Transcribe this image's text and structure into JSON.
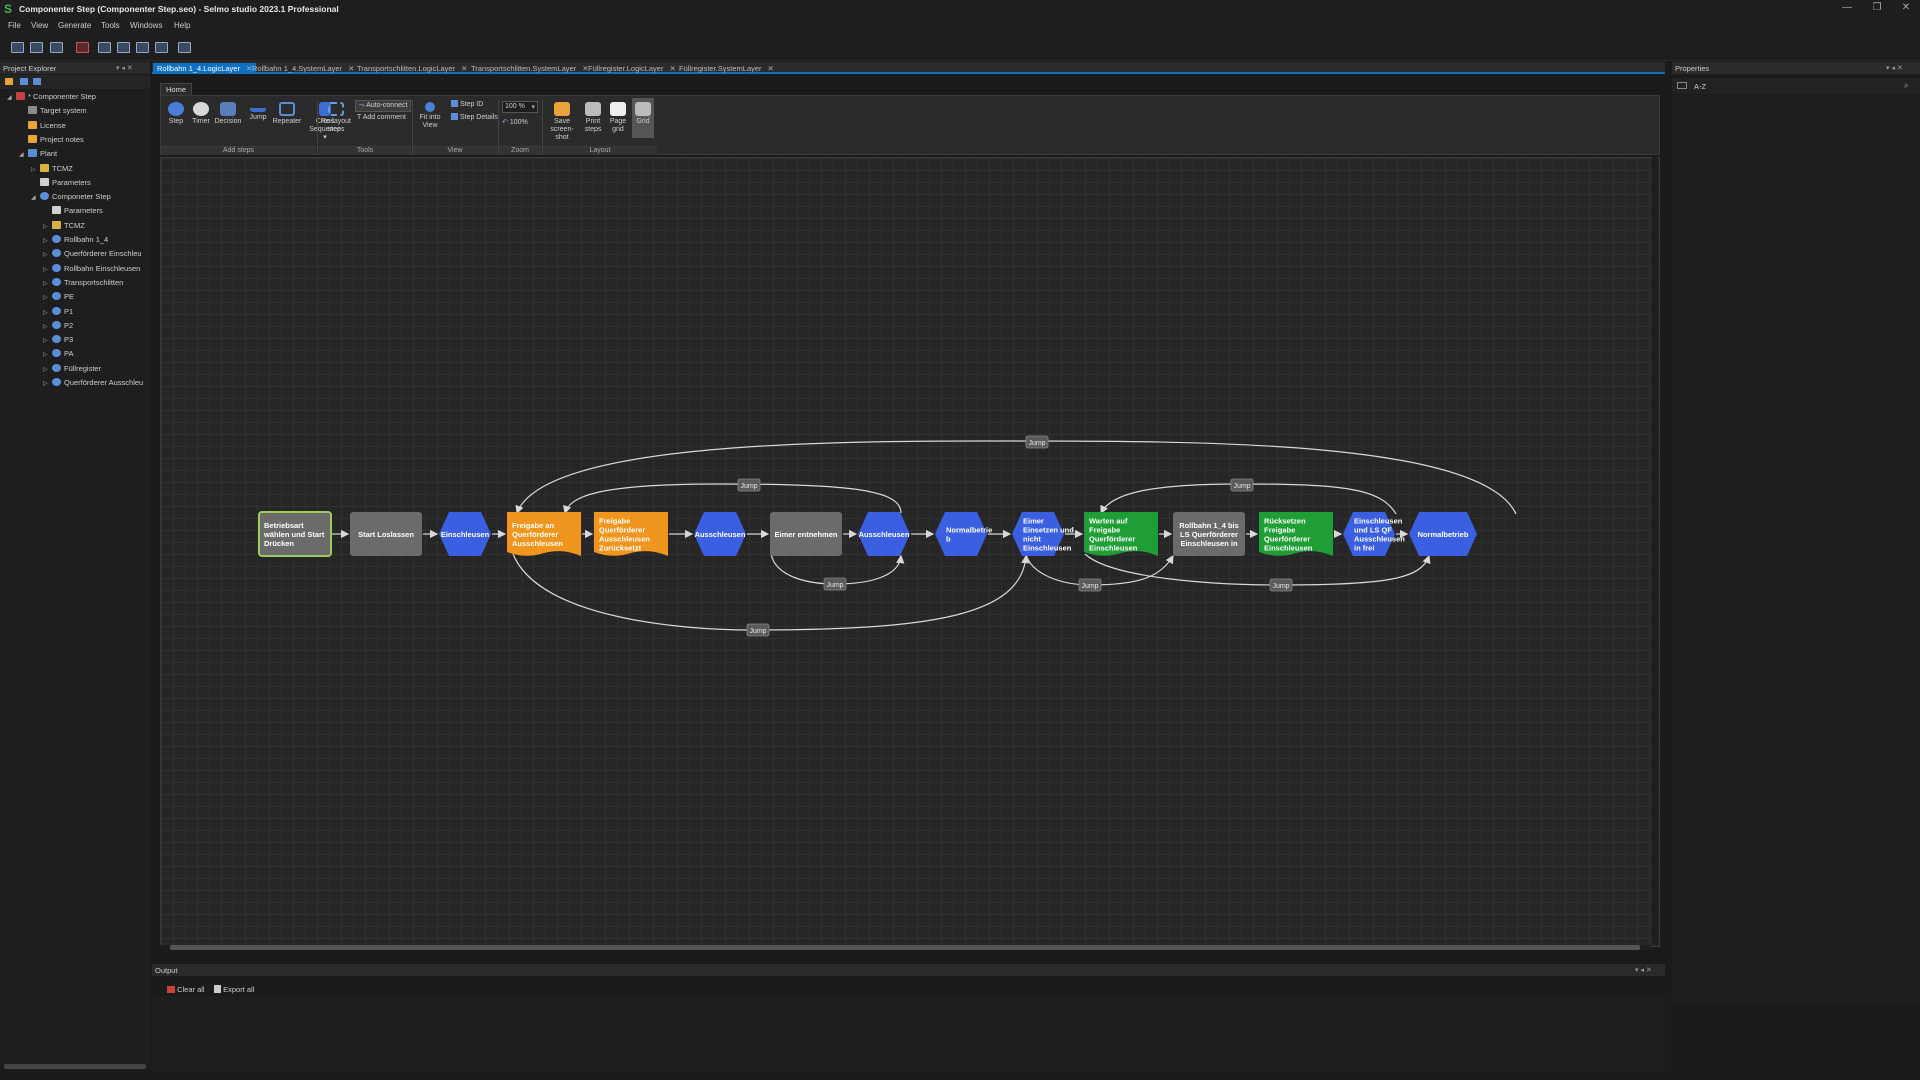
{
  "app": {
    "title": "Componenter Step (Componenter Step.seo) - Selmo studio 2023.1 Professional",
    "logo_glyph": "S",
    "window_buttons": [
      "—",
      "❐",
      "✕"
    ]
  },
  "menu": [
    "File",
    "View",
    "Generate",
    "Tools",
    "Windows",
    "Help"
  ],
  "project_explorer": {
    "title": "Project Explorer",
    "tree": [
      {
        "label": "* Componenter Step",
        "depth": 0,
        "arrow": "◢",
        "icon": "project-icon"
      },
      {
        "label": "Target system",
        "depth": 1,
        "arrow": "",
        "icon": "target-icon"
      },
      {
        "label": "License",
        "depth": 1,
        "arrow": "",
        "icon": "license-icon"
      },
      {
        "label": "Project notes",
        "depth": 1,
        "arrow": "",
        "icon": "notes-icon"
      },
      {
        "label": "Plant",
        "depth": 1,
        "arrow": "◢",
        "icon": "plant-icon"
      },
      {
        "label": "TCMZ",
        "depth": 2,
        "arrow": "▷",
        "icon": "folder-icon"
      },
      {
        "label": "Parameters",
        "depth": 2,
        "arrow": "",
        "icon": "parameters-icon"
      },
      {
        "label": "Componeter Step",
        "depth": 2,
        "arrow": "◢",
        "icon": "component-icon"
      },
      {
        "label": "Parameters",
        "depth": 3,
        "arrow": "",
        "icon": "parameters-icon"
      },
      {
        "label": "TCMZ",
        "depth": 3,
        "arrow": "▷",
        "icon": "folder-icon"
      },
      {
        "label": "Rollbahn 1_4",
        "depth": 3,
        "arrow": "▷",
        "icon": "component-icon"
      },
      {
        "label": "Querförderer Einschleu",
        "depth": 3,
        "arrow": "▷",
        "icon": "component-icon"
      },
      {
        "label": "Rollbahn Einschleusen",
        "depth": 3,
        "arrow": "▷",
        "icon": "component-icon"
      },
      {
        "label": "Transportschlitten",
        "depth": 3,
        "arrow": "▷",
        "icon": "component-icon"
      },
      {
        "label": "PE",
        "depth": 3,
        "arrow": "▷",
        "icon": "component-icon"
      },
      {
        "label": "P1",
        "depth": 3,
        "arrow": "▷",
        "icon": "component-icon"
      },
      {
        "label": "P2",
        "depth": 3,
        "arrow": "▷",
        "icon": "component-icon"
      },
      {
        "label": "P3",
        "depth": 3,
        "arrow": "▷",
        "icon": "component-icon"
      },
      {
        "label": "PA",
        "depth": 3,
        "arrow": "▷",
        "icon": "component-icon"
      },
      {
        "label": "Füllregister",
        "depth": 3,
        "arrow": "▷",
        "icon": "component-icon"
      },
      {
        "label": "Querförderer Ausschleu",
        "depth": 3,
        "arrow": "▷",
        "icon": "component-icon"
      }
    ]
  },
  "tabs": [
    {
      "label": "Rollbahn 1_4.LogicLayer",
      "active": true
    },
    {
      "label": "Rollbahn 1_4.SystemLayer",
      "active": false
    },
    {
      "label": "Transportschlitten.LogicLayer",
      "active": false
    },
    {
      "label": "Transportschlitten.SystemLayer",
      "active": false
    },
    {
      "label": "Füllregister.LogicLayer",
      "active": false
    },
    {
      "label": "Füllregister.SystemLayer",
      "active": false
    }
  ],
  "tab_close_glyph": "✕",
  "ribbon": {
    "tab": "Home",
    "buttons": {
      "step": "Step",
      "timer": "Timer",
      "decision": "Decision",
      "jump": "Jump",
      "repeater": "Repeater",
      "cross_sequence": "Cross Sequence ▾",
      "relayout": "Re-layout steps",
      "auto_connect": "Auto-connect",
      "add_comment": "Add comment",
      "fit_into_view": "Fit into View",
      "step_id": "Step ID",
      "step_details": "Step Details",
      "zoom_value": "100 %",
      "zoom_reset": "100%",
      "save_screenshot": "Save screen-shot",
      "print_steps": "Print steps",
      "page_grid": "Page grid",
      "grid": "Grid"
    },
    "groups": {
      "add_steps": "Add steps",
      "tools": "Tools",
      "view": "View",
      "zoom": "Zoom",
      "layout": "Layout"
    },
    "colors": {
      "step": "#4a7fd4",
      "timer": "#d8d8d8",
      "decision": "#5a7fb8",
      "jump": "#3c6fd0",
      "repeater": "#5a8fd8",
      "save": "#e8a43a"
    }
  },
  "diagram": {
    "colors": {
      "blue": "#3a5fe0",
      "orange": "#f0961e",
      "gray": "#6b6b6b",
      "green": "#1f9e35",
      "init_border": "#9ccc5a",
      "line": "#d8d8d8",
      "jump_label_bg": "#5a5a5a"
    },
    "steps": [
      {
        "id": "s1",
        "text": [
          "Betriebsart",
          "wählen und Start",
          "Drücken"
        ],
        "kind": "init"
      },
      {
        "id": "s2",
        "text": [
          "Start Loslassen"
        ],
        "kind": "gray"
      },
      {
        "id": "s3",
        "text": [
          "Einschleusen"
        ],
        "kind": "blue-hex"
      },
      {
        "id": "s4",
        "text": [
          "Freigabe an",
          "Querförderer",
          "Ausschleusen"
        ],
        "kind": "orange"
      },
      {
        "id": "s5",
        "text": [
          "Freigabe",
          "Querförderer",
          "Ausschleusen",
          "Zurücksetzt"
        ],
        "kind": "orange"
      },
      {
        "id": "s6",
        "text": [
          "Ausschleusen"
        ],
        "kind": "blue-hex"
      },
      {
        "id": "s7",
        "text": [
          "Eimer entnehmen"
        ],
        "kind": "gray"
      },
      {
        "id": "s8",
        "text": [
          "Ausschleusen"
        ],
        "kind": "blue-hex"
      },
      {
        "id": "s9",
        "text": [
          "Normalbetrie",
          "b"
        ],
        "kind": "blue-hex"
      },
      {
        "id": "s10",
        "text": [
          "Eimer",
          "Einsetzen und",
          "nicht",
          "Einschleusen"
        ],
        "kind": "blue-hex"
      },
      {
        "id": "s11",
        "text": [
          "Warten auf",
          "Freigabe",
          "Querförderer",
          "Einschleusen"
        ],
        "kind": "green"
      },
      {
        "id": "s12",
        "text": [
          "Rollbahn 1_4 bis",
          "LS Querförderer",
          "Einschleusen in"
        ],
        "kind": "gray"
      },
      {
        "id": "s13",
        "text": [
          "Rücksetzen",
          "Freigabe",
          "Querförderer",
          "Einschleusen"
        ],
        "kind": "green"
      },
      {
        "id": "s14",
        "text": [
          "Einschleusen",
          "und LS QF",
          "Ausschleusen",
          "in frei"
        ],
        "kind": "blue-hex"
      },
      {
        "id": "s15",
        "text": [
          "Normalbetrieb"
        ],
        "kind": "blue-hex"
      }
    ],
    "jump_label": "Jump"
  },
  "output": {
    "title": "Output",
    "clear_all": "Clear all",
    "export_all": "Export all"
  },
  "properties": {
    "title": "Properties",
    "sort_az": "A-Z"
  },
  "panel_glyphs": {
    "pin": "▾ ◂ ✕"
  }
}
